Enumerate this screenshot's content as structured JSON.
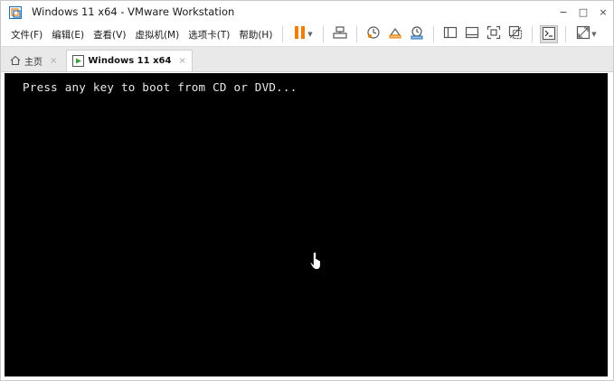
{
  "window": {
    "title": "Windows 11 x64 - VMware Workstation",
    "controls": {
      "minimize": "−",
      "maximize": "□",
      "close": "×"
    }
  },
  "menu": {
    "items": [
      "文件(F)",
      "编辑(E)",
      "查看(V)",
      "虚拟机(M)",
      "选项卡(T)",
      "帮助(H)"
    ]
  },
  "toolbar": {
    "icons": [
      "pause-icon",
      "send-ctrl-alt-del-icon",
      "snapshot-icon",
      "revert-snapshot-icon",
      "snapshot-manager-icon",
      "show-library-icon",
      "thumbnail-bar-icon",
      "full-screen-icon",
      "unity-icon",
      "console-view-icon",
      "stretch-guest-icon"
    ],
    "accent": "#f07c00"
  },
  "tabs": [
    {
      "label": "主页",
      "close": "×",
      "active": false
    },
    {
      "label": "Windows 11 x64",
      "close": "×",
      "active": true
    }
  ],
  "console": {
    "text": "Press any key to boot from CD or DVD...",
    "background": "#000000",
    "foreground": "#e8e8e8"
  }
}
